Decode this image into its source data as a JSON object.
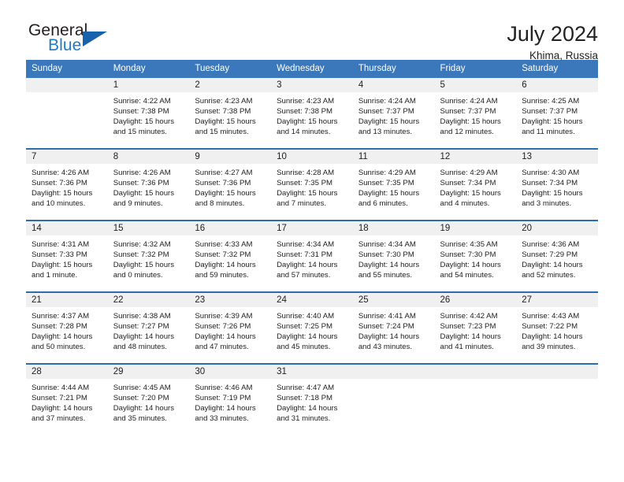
{
  "brand": {
    "name_top": "General",
    "name_bottom": "Blue",
    "triangle_color": "#1763ab",
    "blue_color": "#1f7ac4",
    "dark_color": "#231f20"
  },
  "header": {
    "title": "July 2024",
    "subtitle": "Khima, Russia"
  },
  "theme": {
    "header_bar_color": "#3a77bb",
    "row_separator_color": "#2d6da9",
    "daynum_band_color": "#f0f0f0",
    "text_color": "#222222"
  },
  "weekday_headers": [
    "Sunday",
    "Monday",
    "Tuesday",
    "Wednesday",
    "Thursday",
    "Friday",
    "Saturday"
  ],
  "labels": {
    "sunrise_prefix": "Sunrise:",
    "sunset_prefix": "Sunset:",
    "daylight_prefix": "Daylight:"
  },
  "weeks": [
    [
      {
        "day": "",
        "sunrise": "",
        "sunset": "",
        "daylight_line1": "",
        "daylight_line2": "",
        "empty": true
      },
      {
        "day": "1",
        "sunrise": "Sunrise: 4:22 AM",
        "sunset": "Sunset: 7:38 PM",
        "daylight_line1": "Daylight: 15 hours",
        "daylight_line2": "and 15 minutes."
      },
      {
        "day": "2",
        "sunrise": "Sunrise: 4:23 AM",
        "sunset": "Sunset: 7:38 PM",
        "daylight_line1": "Daylight: 15 hours",
        "daylight_line2": "and 15 minutes."
      },
      {
        "day": "3",
        "sunrise": "Sunrise: 4:23 AM",
        "sunset": "Sunset: 7:38 PM",
        "daylight_line1": "Daylight: 15 hours",
        "daylight_line2": "and 14 minutes."
      },
      {
        "day": "4",
        "sunrise": "Sunrise: 4:24 AM",
        "sunset": "Sunset: 7:37 PM",
        "daylight_line1": "Daylight: 15 hours",
        "daylight_line2": "and 13 minutes."
      },
      {
        "day": "5",
        "sunrise": "Sunrise: 4:24 AM",
        "sunset": "Sunset: 7:37 PM",
        "daylight_line1": "Daylight: 15 hours",
        "daylight_line2": "and 12 minutes."
      },
      {
        "day": "6",
        "sunrise": "Sunrise: 4:25 AM",
        "sunset": "Sunset: 7:37 PM",
        "daylight_line1": "Daylight: 15 hours",
        "daylight_line2": "and 11 minutes."
      }
    ],
    [
      {
        "day": "7",
        "sunrise": "Sunrise: 4:26 AM",
        "sunset": "Sunset: 7:36 PM",
        "daylight_line1": "Daylight: 15 hours",
        "daylight_line2": "and 10 minutes."
      },
      {
        "day": "8",
        "sunrise": "Sunrise: 4:26 AM",
        "sunset": "Sunset: 7:36 PM",
        "daylight_line1": "Daylight: 15 hours",
        "daylight_line2": "and 9 minutes."
      },
      {
        "day": "9",
        "sunrise": "Sunrise: 4:27 AM",
        "sunset": "Sunset: 7:36 PM",
        "daylight_line1": "Daylight: 15 hours",
        "daylight_line2": "and 8 minutes."
      },
      {
        "day": "10",
        "sunrise": "Sunrise: 4:28 AM",
        "sunset": "Sunset: 7:35 PM",
        "daylight_line1": "Daylight: 15 hours",
        "daylight_line2": "and 7 minutes."
      },
      {
        "day": "11",
        "sunrise": "Sunrise: 4:29 AM",
        "sunset": "Sunset: 7:35 PM",
        "daylight_line1": "Daylight: 15 hours",
        "daylight_line2": "and 6 minutes."
      },
      {
        "day": "12",
        "sunrise": "Sunrise: 4:29 AM",
        "sunset": "Sunset: 7:34 PM",
        "daylight_line1": "Daylight: 15 hours",
        "daylight_line2": "and 4 minutes."
      },
      {
        "day": "13",
        "sunrise": "Sunrise: 4:30 AM",
        "sunset": "Sunset: 7:34 PM",
        "daylight_line1": "Daylight: 15 hours",
        "daylight_line2": "and 3 minutes."
      }
    ],
    [
      {
        "day": "14",
        "sunrise": "Sunrise: 4:31 AM",
        "sunset": "Sunset: 7:33 PM",
        "daylight_line1": "Daylight: 15 hours",
        "daylight_line2": "and 1 minute."
      },
      {
        "day": "15",
        "sunrise": "Sunrise: 4:32 AM",
        "sunset": "Sunset: 7:32 PM",
        "daylight_line1": "Daylight: 15 hours",
        "daylight_line2": "and 0 minutes."
      },
      {
        "day": "16",
        "sunrise": "Sunrise: 4:33 AM",
        "sunset": "Sunset: 7:32 PM",
        "daylight_line1": "Daylight: 14 hours",
        "daylight_line2": "and 59 minutes."
      },
      {
        "day": "17",
        "sunrise": "Sunrise: 4:34 AM",
        "sunset": "Sunset: 7:31 PM",
        "daylight_line1": "Daylight: 14 hours",
        "daylight_line2": "and 57 minutes."
      },
      {
        "day": "18",
        "sunrise": "Sunrise: 4:34 AM",
        "sunset": "Sunset: 7:30 PM",
        "daylight_line1": "Daylight: 14 hours",
        "daylight_line2": "and 55 minutes."
      },
      {
        "day": "19",
        "sunrise": "Sunrise: 4:35 AM",
        "sunset": "Sunset: 7:30 PM",
        "daylight_line1": "Daylight: 14 hours",
        "daylight_line2": "and 54 minutes."
      },
      {
        "day": "20",
        "sunrise": "Sunrise: 4:36 AM",
        "sunset": "Sunset: 7:29 PM",
        "daylight_line1": "Daylight: 14 hours",
        "daylight_line2": "and 52 minutes."
      }
    ],
    [
      {
        "day": "21",
        "sunrise": "Sunrise: 4:37 AM",
        "sunset": "Sunset: 7:28 PM",
        "daylight_line1": "Daylight: 14 hours",
        "daylight_line2": "and 50 minutes."
      },
      {
        "day": "22",
        "sunrise": "Sunrise: 4:38 AM",
        "sunset": "Sunset: 7:27 PM",
        "daylight_line1": "Daylight: 14 hours",
        "daylight_line2": "and 48 minutes."
      },
      {
        "day": "23",
        "sunrise": "Sunrise: 4:39 AM",
        "sunset": "Sunset: 7:26 PM",
        "daylight_line1": "Daylight: 14 hours",
        "daylight_line2": "and 47 minutes."
      },
      {
        "day": "24",
        "sunrise": "Sunrise: 4:40 AM",
        "sunset": "Sunset: 7:25 PM",
        "daylight_line1": "Daylight: 14 hours",
        "daylight_line2": "and 45 minutes."
      },
      {
        "day": "25",
        "sunrise": "Sunrise: 4:41 AM",
        "sunset": "Sunset: 7:24 PM",
        "daylight_line1": "Daylight: 14 hours",
        "daylight_line2": "and 43 minutes."
      },
      {
        "day": "26",
        "sunrise": "Sunrise: 4:42 AM",
        "sunset": "Sunset: 7:23 PM",
        "daylight_line1": "Daylight: 14 hours",
        "daylight_line2": "and 41 minutes."
      },
      {
        "day": "27",
        "sunrise": "Sunrise: 4:43 AM",
        "sunset": "Sunset: 7:22 PM",
        "daylight_line1": "Daylight: 14 hours",
        "daylight_line2": "and 39 minutes."
      }
    ],
    [
      {
        "day": "28",
        "sunrise": "Sunrise: 4:44 AM",
        "sunset": "Sunset: 7:21 PM",
        "daylight_line1": "Daylight: 14 hours",
        "daylight_line2": "and 37 minutes."
      },
      {
        "day": "29",
        "sunrise": "Sunrise: 4:45 AM",
        "sunset": "Sunset: 7:20 PM",
        "daylight_line1": "Daylight: 14 hours",
        "daylight_line2": "and 35 minutes."
      },
      {
        "day": "30",
        "sunrise": "Sunrise: 4:46 AM",
        "sunset": "Sunset: 7:19 PM",
        "daylight_line1": "Daylight: 14 hours",
        "daylight_line2": "and 33 minutes."
      },
      {
        "day": "31",
        "sunrise": "Sunrise: 4:47 AM",
        "sunset": "Sunset: 7:18 PM",
        "daylight_line1": "Daylight: 14 hours",
        "daylight_line2": "and 31 minutes."
      },
      {
        "day": "",
        "sunrise": "",
        "sunset": "",
        "daylight_line1": "",
        "daylight_line2": "",
        "empty": true
      },
      {
        "day": "",
        "sunrise": "",
        "sunset": "",
        "daylight_line1": "",
        "daylight_line2": "",
        "empty": true
      },
      {
        "day": "",
        "sunrise": "",
        "sunset": "",
        "daylight_line1": "",
        "daylight_line2": "",
        "empty": true
      }
    ]
  ]
}
